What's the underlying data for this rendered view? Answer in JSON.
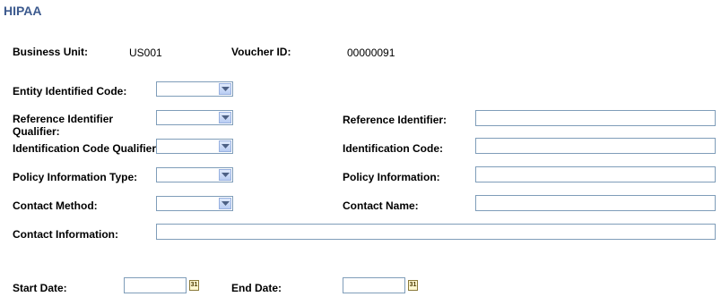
{
  "page": {
    "title": "HIPAA"
  },
  "header": {
    "business_unit_label": "Business Unit:",
    "business_unit_value": "US001",
    "voucher_id_label": "Voucher ID:",
    "voucher_id_value": "00000091"
  },
  "form": {
    "entity_identified_code_label": "Entity Identified Code:",
    "reference_identifier_qualifier_label": "Reference Identifier Qualifier:",
    "reference_identifier_label": "Reference Identifier:",
    "identification_code_qualifier_label": "Identification Code Qualifier:",
    "identification_code_label": "Identification Code:",
    "policy_information_type_label": "Policy Information Type:",
    "policy_information_label": "Policy Information:",
    "contact_method_label": "Contact Method:",
    "contact_name_label": "Contact Name:",
    "contact_information_label": "Contact Information:"
  },
  "dates": {
    "start_date_label": "Start Date:",
    "end_date_label": "End Date:",
    "calendar_glyph": "31"
  },
  "icons": {
    "dropdown": "chevron-down-icon",
    "calendar": "calendar-icon"
  },
  "colors": {
    "title": "#3c5a8e",
    "field_border": "#7f9db9"
  }
}
